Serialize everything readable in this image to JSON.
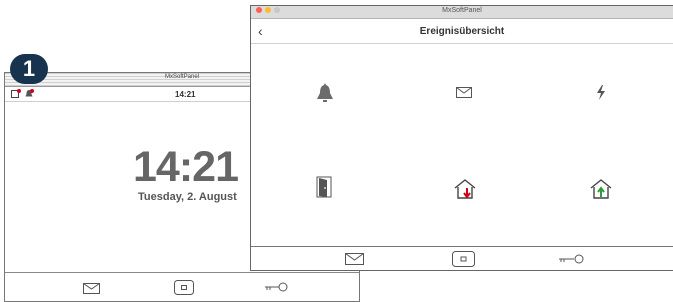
{
  "back_window": {
    "title": "MxSoftPanel",
    "status_time": "14:21",
    "clock": "14:21",
    "date": "Tuesday, 2. August"
  },
  "step_badge": "1",
  "front_window": {
    "title": "MxSoftPanel",
    "nav_title": "Ereignisübersicht",
    "back_glyph": "‹",
    "event_icons": [
      "bell-icon",
      "envelope-icon",
      "lightning-icon",
      "door-icon",
      "house-alarm-icon",
      "house-check-icon"
    ]
  },
  "colors": {
    "badge": "#17334d",
    "alert": "#d0021b",
    "ok": "#2e9b3a",
    "icon_gray": "#6b6b6b"
  }
}
